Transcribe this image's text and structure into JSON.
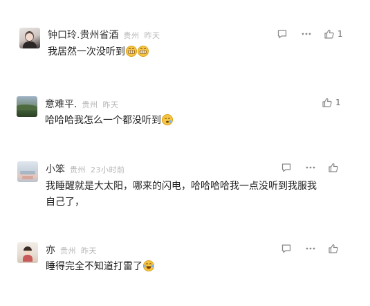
{
  "comments": [
    {
      "user": "钟口玲.贵州省酒",
      "location": "贵州",
      "time": "昨天",
      "text": "我居然一次没听到",
      "emoji_count": 2,
      "emoji_type": "grin",
      "likes": "1",
      "show_reply": true,
      "show_more": true
    },
    {
      "user": "意难平.",
      "location": "贵州",
      "time": "昨天",
      "text": "哈哈哈我怎么一个都没听到",
      "emoji_count": 1,
      "emoji_type": "sleepy",
      "likes": "1",
      "show_reply": false,
      "show_more": false
    },
    {
      "user": "小笨",
      "location": "贵州",
      "time": "23小时前",
      "text_line1": "我睡醒就是大太阳，哪来的闪电，哈哈哈哈我一点没听到我服我",
      "text_line2": "自己了，",
      "likes": "",
      "show_reply": true,
      "show_more": true
    },
    {
      "user": "亦",
      "location": "贵州",
      "time": "昨天",
      "text": "睡得完全不知道打雷了",
      "emoji_count": 1,
      "emoji_type": "laugh-tears",
      "likes": "",
      "show_reply": true,
      "show_more": true
    }
  ],
  "icons": {
    "reply": "comment-icon",
    "more": "more-dots-icon",
    "like": "thumbs-up-icon"
  },
  "colors": {
    "emoji_yellow": "#f7c544",
    "meta_gray": "#b5b5b5",
    "icon_gray": "#8a8a8a"
  }
}
